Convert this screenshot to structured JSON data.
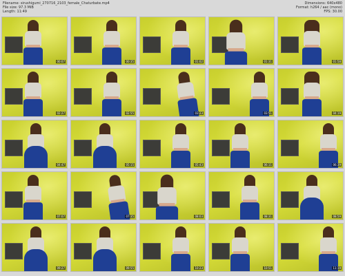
{
  "header": {
    "filename": "Filename: sirushigumi_270716_2103_female_Chaturbate.mp4",
    "filesize": "File size: 97.3 MiB",
    "length": "Length: 11:49",
    "dimensions": "Dimensions: 640x480",
    "format": "Format: h264 / aac (mono)",
    "fps": "FPS: 30.00"
  },
  "thumbnails": [
    {
      "time": "00:07",
      "pose": "p1"
    },
    {
      "time": "00:35",
      "pose": "p2"
    },
    {
      "time": "01:02",
      "pose": "p2"
    },
    {
      "time": "01:31",
      "pose": "p4"
    },
    {
      "time": "01:58",
      "pose": "p7"
    },
    {
      "time": "02:27",
      "pose": "p1"
    },
    {
      "time": "02:55",
      "pose": "p2"
    },
    {
      "time": "03:23",
      "pose": "p3"
    },
    {
      "time": "03:51",
      "pose": "p6"
    },
    {
      "time": "04:19",
      "pose": "p7"
    },
    {
      "time": "04:47",
      "pose": "p5"
    },
    {
      "time": "05:15",
      "pose": "p5"
    },
    {
      "time": "05:43",
      "pose": "p2"
    },
    {
      "time": "06:11",
      "pose": "p1"
    },
    {
      "time": "06:39",
      "pose": "p6"
    },
    {
      "time": "07:07",
      "pose": "p1"
    },
    {
      "time": "07:35",
      "pose": "p3"
    },
    {
      "time": "08:03",
      "pose": "p4"
    },
    {
      "time": "08:31",
      "pose": "p2"
    },
    {
      "time": "08:59",
      "pose": "p5"
    },
    {
      "time": "09:27",
      "pose": "p5"
    },
    {
      "time": "09:55",
      "pose": "p5"
    },
    {
      "time": "10:23",
      "pose": "p2"
    },
    {
      "time": "10:51",
      "pose": "p1"
    },
    {
      "time": "11:19",
      "pose": "p6"
    }
  ]
}
